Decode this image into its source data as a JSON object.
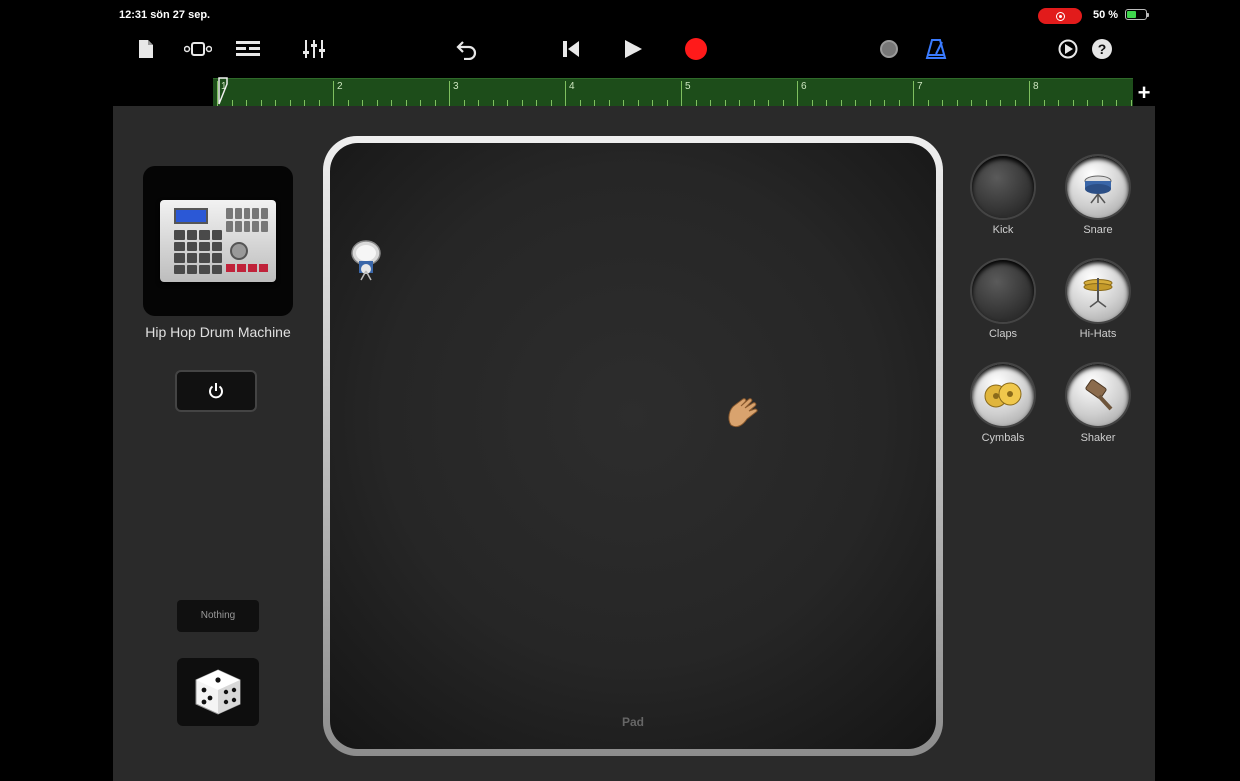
{
  "status_bar": {
    "time": "12:31  sön 27 sep.",
    "battery_text": "50 %",
    "battery_level": 0.5,
    "recording_color": "#e21b1b"
  },
  "toolbar": {
    "icons": [
      "document-icon",
      "view-toggle-icon",
      "tracks-icon",
      "mixer-icon",
      "undo-icon",
      "go-to-start-icon",
      "play-icon",
      "record-icon",
      "loop-icon",
      "metronome-icon",
      "settings-icon",
      "help-icon"
    ],
    "help_label": "?",
    "record_color": "#ff1a1a",
    "metronome_color": "#3a7bff"
  },
  "ruler": {
    "bars": [
      "1",
      "2",
      "3",
      "4",
      "5",
      "6",
      "7",
      "8"
    ],
    "add_label": "+",
    "color": "#1d4d1a"
  },
  "instrument": {
    "name": "Hip Hop Drum Machine",
    "power_icon": "power-icon"
  },
  "pad": {
    "label": "Pad"
  },
  "drum_buttons": [
    {
      "label": "Kick",
      "active": false,
      "icon": "kick-drum-icon"
    },
    {
      "label": "Snare",
      "active": true,
      "icon": "snare-drum-icon"
    },
    {
      "label": "Claps",
      "active": false,
      "icon": "claps-icon"
    },
    {
      "label": "Hi-Hats",
      "active": true,
      "icon": "hi-hat-icon"
    },
    {
      "label": "Cymbals",
      "active": true,
      "icon": "cymbals-icon"
    },
    {
      "label": "Shaker",
      "active": true,
      "icon": "shaker-icon"
    }
  ],
  "preset": {
    "label": "Nothing"
  }
}
